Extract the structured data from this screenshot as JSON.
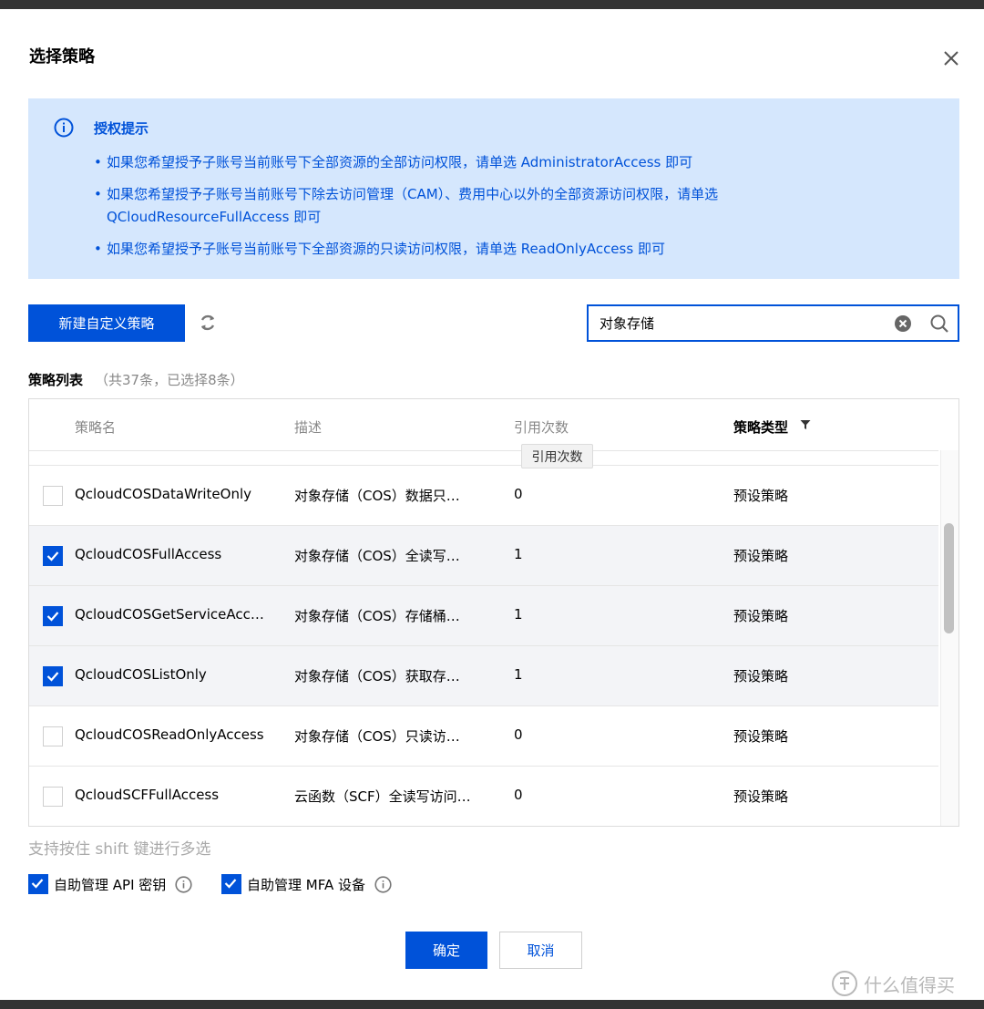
{
  "dialog": {
    "title": "选择策略",
    "close_icon": "close-icon"
  },
  "notice": {
    "icon": "info-circle-icon",
    "title": "授权提示",
    "items": [
      {
        "bullet": "•",
        "lines": [
          "如果您希望授予子账号当前账号下全部资源的全部访问权限，请单选 AdministratorAccess 即可"
        ]
      },
      {
        "bullet": "•",
        "lines": [
          "如果您希望授予子账号当前账号下除去访问管理（CAM）、费用中心以外的全部资源访问权限，请单选",
          "QCloudResourceFullAccess 即可"
        ]
      },
      {
        "bullet": "•",
        "lines": [
          "如果您希望授予子账号当前账号下全部资源的只读访问权限，请单选 ReadOnlyAccess 即可"
        ]
      }
    ]
  },
  "toolbar": {
    "new_policy_label": "新建自定义策略",
    "refresh_icon": "refresh-icon",
    "search_value": "对象存储",
    "clear_icon": "clear-circle-icon",
    "search_icon": "search-icon"
  },
  "list": {
    "label": "策略列表",
    "count": "（共37条，已选择8条）",
    "columns": {
      "name": "策略名",
      "desc": "描述",
      "count": "引用次数",
      "type": "策略类型"
    },
    "tooltip": "引用次数",
    "rows": [
      {
        "checked": false,
        "name": "QcloudCOSDataWriteOnly",
        "desc": "对象存储（COS）数据只…",
        "count": "0",
        "type": "预设策略"
      },
      {
        "checked": true,
        "name": "QcloudCOSFullAccess",
        "desc": "对象存储（COS）全读写…",
        "count": "1",
        "type": "预设策略"
      },
      {
        "checked": true,
        "name": "QcloudCOSGetServiceAcc…",
        "desc": "对象存储（COS）存储桶…",
        "count": "1",
        "type": "预设策略"
      },
      {
        "checked": true,
        "name": "QcloudCOSListOnly",
        "desc": "对象存储（COS）获取存…",
        "count": "1",
        "type": "预设策略"
      },
      {
        "checked": false,
        "name": "QcloudCOSReadOnlyAccess",
        "desc": "对象存储（COS）只读访…",
        "count": "0",
        "type": "预设策略"
      },
      {
        "checked": false,
        "name": "QcloudSCFFullAccess",
        "desc": "云函数（SCF）全读写访问…",
        "count": "0",
        "type": "预设策略"
      }
    ]
  },
  "footer": {
    "hint": "支持按住 shift 键进行多选",
    "opt_api": "自助管理 API 密钥",
    "opt_mfa": "自助管理 MFA 设备",
    "ok_label": "确定",
    "cancel_label": "取消"
  },
  "watermark": {
    "text": "什么值得买"
  },
  "colors": {
    "accent": "#0052d9",
    "notice_bg": "#d5e7fd",
    "selected_row": "#f3f4f7"
  }
}
